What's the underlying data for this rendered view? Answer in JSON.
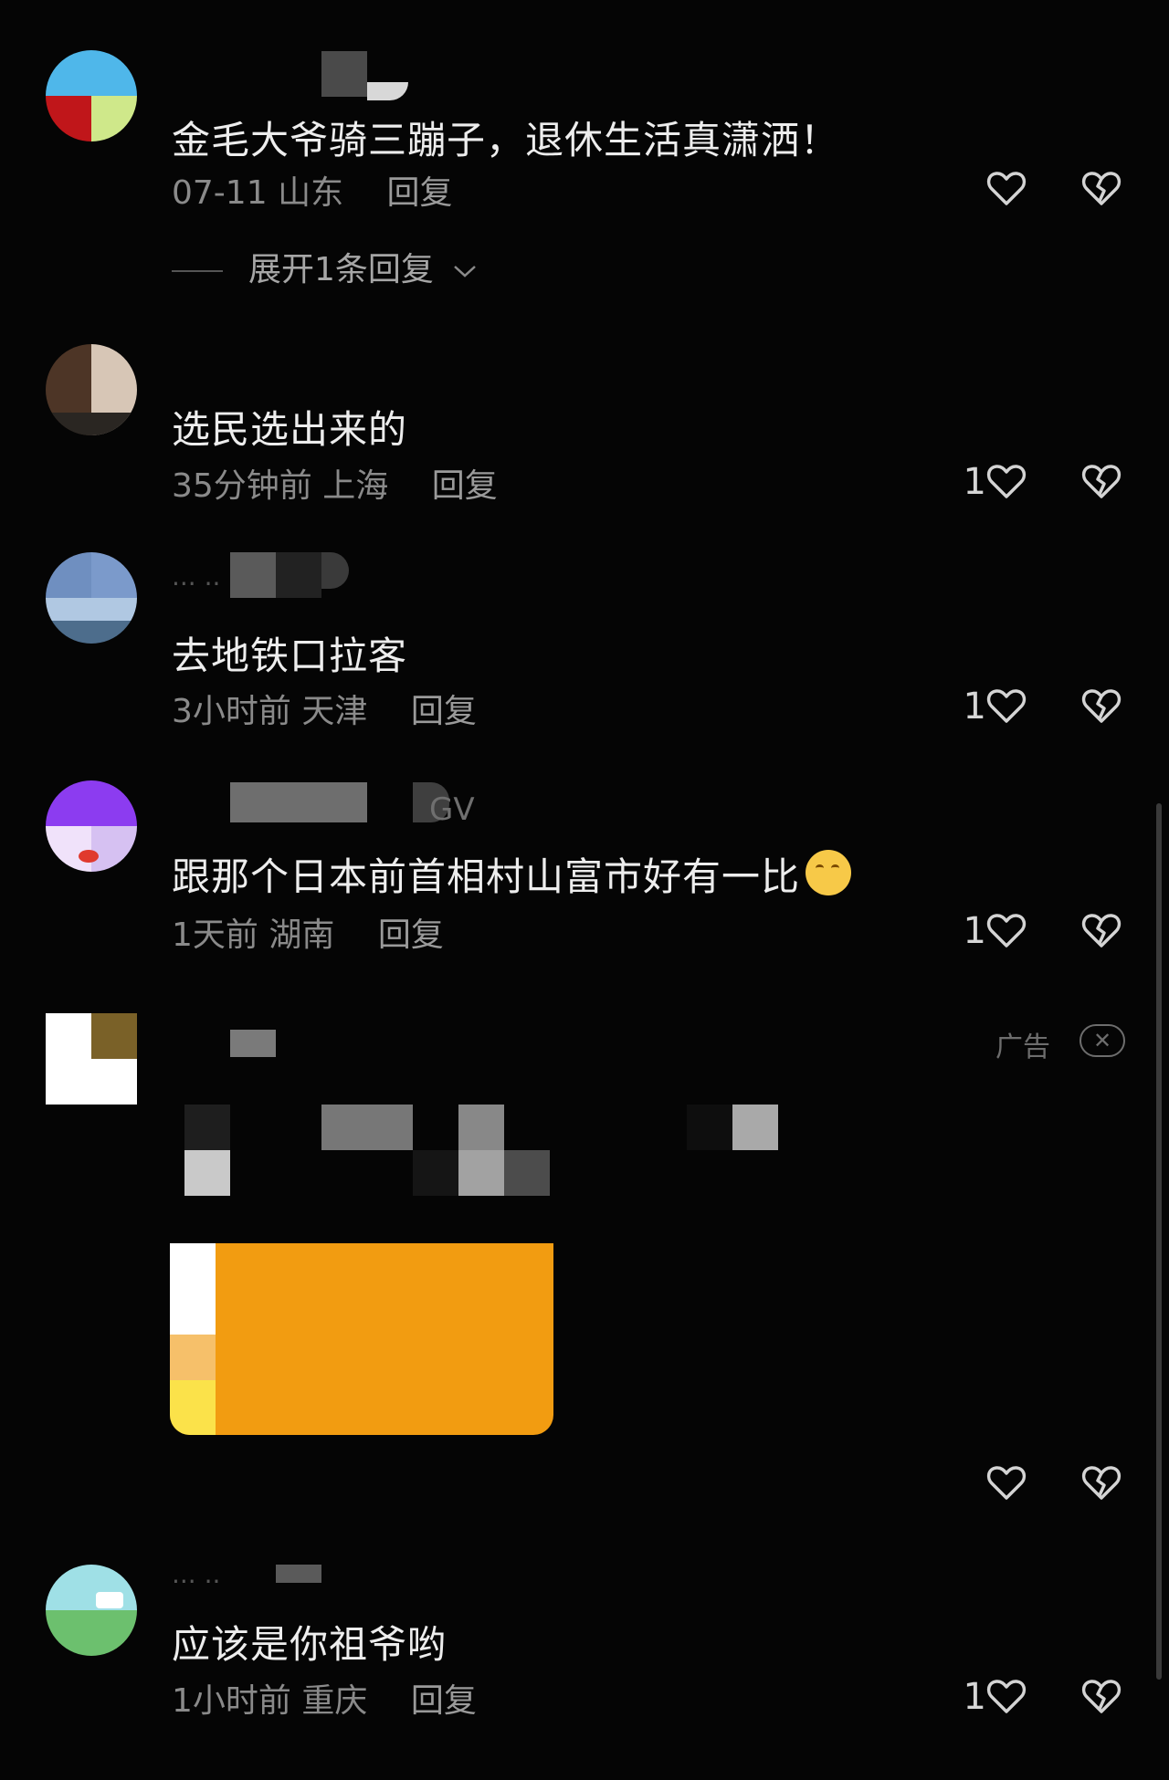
{
  "comments": [
    {
      "text": "金毛大爷骑三蹦子，退休生活真潇洒！",
      "time": "07-11",
      "location": "山东",
      "reply": "回复",
      "likes": "",
      "expand": "展开1条回复"
    },
    {
      "text": "选民选出来的",
      "time": "35分钟前",
      "location": "上海",
      "reply": "回复",
      "likes": "1"
    },
    {
      "text": "去地铁口拉客",
      "time": "3小时前",
      "location": "天津",
      "reply": "回复",
      "likes": "1"
    },
    {
      "username_partial": "GV",
      "text": "跟那个日本前首相村山富市好有一比",
      "time": "1天前",
      "location": "湖南",
      "reply": "回复",
      "likes": "1"
    },
    {
      "text": "应该是你祖爷哟",
      "time": "1小时前",
      "location": "重庆",
      "reply": "回复",
      "likes": "1"
    }
  ],
  "ad": {
    "label": "广告",
    "close_icon": "close-icon",
    "banner_color": "#f29c11"
  },
  "icons": {
    "like": "heart-outline-icon",
    "dislike": "broken-heart-icon",
    "expand": "chevron-down-icon"
  }
}
